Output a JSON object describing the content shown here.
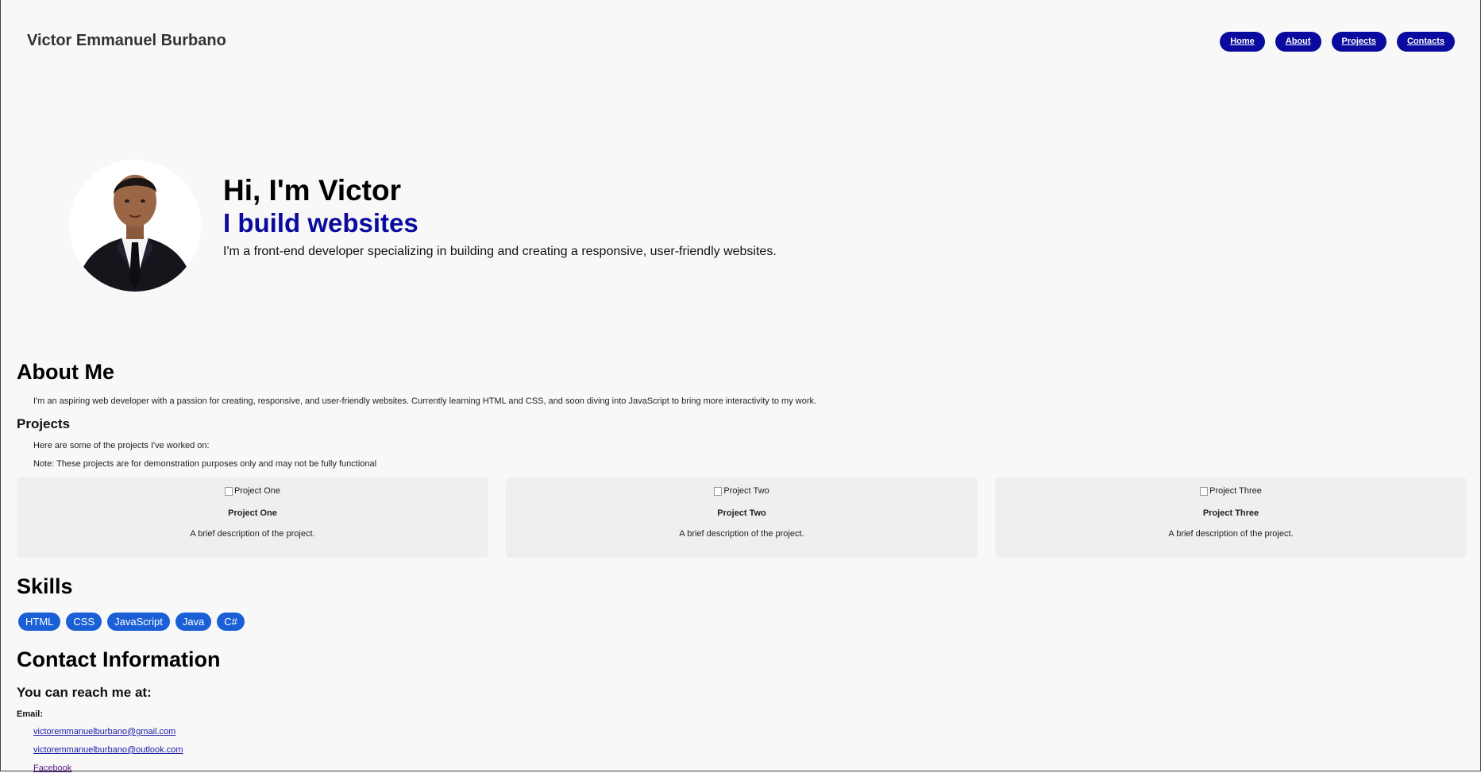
{
  "header": {
    "site_name": "Victor Emmanuel Burbano",
    "nav": [
      "Home",
      "About",
      "Projects",
      "Contacts"
    ]
  },
  "hero": {
    "title": "Hi, I'm Victor",
    "subtitle": "I build websites",
    "description": "I'm a front-end developer specializing in building and creating a responsive, user-friendly websites."
  },
  "about": {
    "heading": "About Me",
    "text": "I'm an aspiring web developer with a passion for creating, responsive, and user-friendly websites. Currently learning HTML and CSS, and soon diving into JavaScript to bring more interactivity to my work."
  },
  "projects": {
    "heading": "Projects",
    "intro": "Here are some of the projects I've worked on:",
    "note": "Note: These projects are for demonstration purposes only and may not be fully functional",
    "items": [
      {
        "img_alt": "Project One",
        "name": "Project One",
        "desc": "A brief description of the project."
      },
      {
        "img_alt": "Project Two",
        "name": "Project Two",
        "desc": "A brief description of the project."
      },
      {
        "img_alt": "Project Three",
        "name": "Project Three",
        "desc": "A brief description of the project."
      }
    ]
  },
  "skills": {
    "heading": "Skills",
    "items": [
      "HTML",
      "CSS",
      "JavaScript",
      "Java",
      "C#"
    ]
  },
  "contact": {
    "heading": "Contact Information",
    "subheading": "You can reach me at:",
    "email_label": "Email:",
    "emails": [
      "victoremmanuelburbano@gmail.com",
      "victoremmanuelburbano@outlook.com"
    ],
    "social": "Facebook"
  },
  "colors": {
    "nav_bg": "#0a0a9e",
    "accent_text": "#0a0a9e",
    "skill_bg": "#1a5fd6",
    "page_bg": "#f8f8f8",
    "card_bg": "#efefef"
  }
}
